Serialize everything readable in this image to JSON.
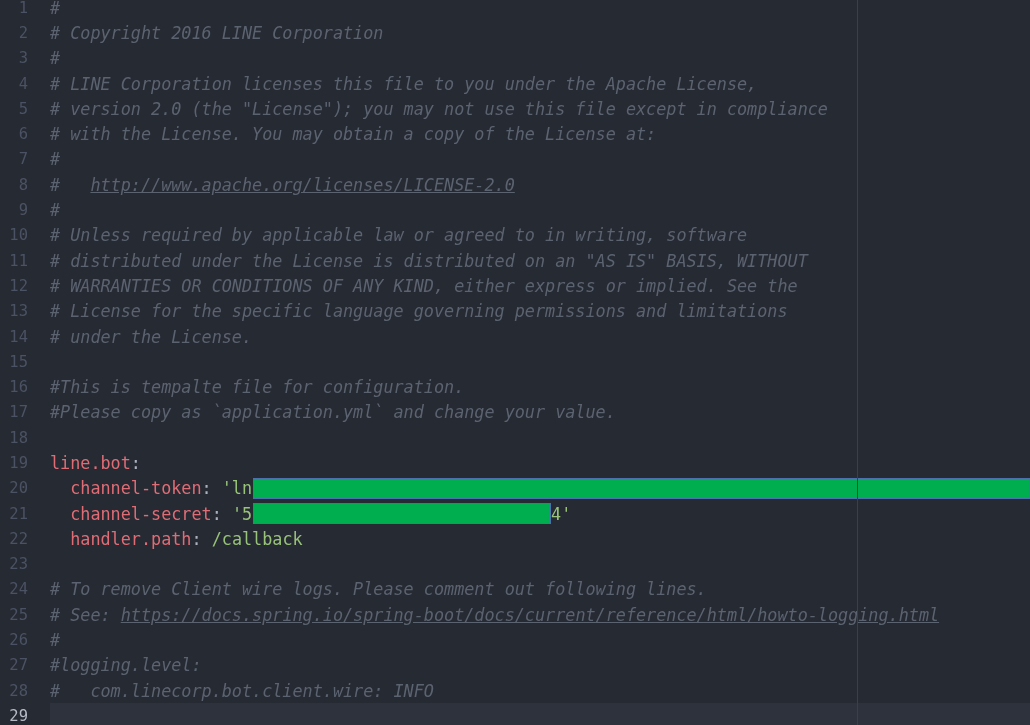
{
  "editor": {
    "lines": [
      {
        "number": "1",
        "current": false,
        "segments": [
          {
            "kind": "comment",
            "text": "#"
          }
        ]
      },
      {
        "number": "2",
        "current": false,
        "segments": [
          {
            "kind": "comment",
            "text": "# Copyright 2016 LINE Corporation"
          }
        ]
      },
      {
        "number": "3",
        "current": false,
        "segments": [
          {
            "kind": "comment",
            "text": "#"
          }
        ]
      },
      {
        "number": "4",
        "current": false,
        "segments": [
          {
            "kind": "comment",
            "text": "# LINE Corporation licenses this file to you under the Apache License,"
          }
        ]
      },
      {
        "number": "5",
        "current": false,
        "segments": [
          {
            "kind": "comment",
            "text": "# version 2.0 (the \"License\"); you may not use this file except in compliance"
          }
        ]
      },
      {
        "number": "6",
        "current": false,
        "segments": [
          {
            "kind": "comment",
            "text": "# with the License. You may obtain a copy of the License at:"
          }
        ]
      },
      {
        "number": "7",
        "current": false,
        "segments": [
          {
            "kind": "comment",
            "text": "#"
          }
        ]
      },
      {
        "number": "8",
        "current": false,
        "segments": [
          {
            "kind": "comment",
            "text": "#   "
          },
          {
            "kind": "link",
            "text": "http://www.apache.org/licenses/LICENSE-2.0"
          }
        ]
      },
      {
        "number": "9",
        "current": false,
        "segments": [
          {
            "kind": "comment",
            "text": "#"
          }
        ]
      },
      {
        "number": "10",
        "current": false,
        "segments": [
          {
            "kind": "comment",
            "text": "# Unless required by applicable law or agreed to in writing, software"
          }
        ]
      },
      {
        "number": "11",
        "current": false,
        "segments": [
          {
            "kind": "comment",
            "text": "# distributed under the License is distributed on an \"AS IS\" BASIS, WITHOUT"
          }
        ]
      },
      {
        "number": "12",
        "current": false,
        "segments": [
          {
            "kind": "comment",
            "text": "# WARRANTIES OR CONDITIONS OF ANY KIND, either express or implied. See the"
          }
        ]
      },
      {
        "number": "13",
        "current": false,
        "segments": [
          {
            "kind": "comment",
            "text": "# License for the specific language governing permissions and limitations"
          }
        ]
      },
      {
        "number": "14",
        "current": false,
        "segments": [
          {
            "kind": "comment",
            "text": "# under the License."
          }
        ]
      },
      {
        "number": "15",
        "current": false
      },
      {
        "number": "16",
        "current": false,
        "segments": [
          {
            "kind": "comment",
            "text": "#This is tempalte file for configuration."
          }
        ]
      },
      {
        "number": "17",
        "current": false,
        "segments": [
          {
            "kind": "comment",
            "text": "#Please copy as `application.yml` and change your value."
          }
        ]
      },
      {
        "number": "18",
        "current": false
      },
      {
        "number": "19",
        "current": false,
        "segments": [
          {
            "kind": "key",
            "text": "line.bot"
          },
          {
            "kind": "punct",
            "text": ":"
          }
        ]
      },
      {
        "number": "20",
        "current": false,
        "indented": true,
        "segments": [
          {
            "kind": "key",
            "text": "channel-token"
          },
          {
            "kind": "punct",
            "text": ": "
          },
          {
            "kind": "string",
            "text": "'ln"
          },
          {
            "kind": "redaction",
            "to_edge": true
          }
        ]
      },
      {
        "number": "21",
        "current": false,
        "indented": true,
        "segments": [
          {
            "kind": "key",
            "text": "channel-secret"
          },
          {
            "kind": "punct",
            "text": ": "
          },
          {
            "kind": "string",
            "text": "'5"
          },
          {
            "kind": "redaction",
            "to_edge": false
          },
          {
            "kind": "string",
            "text": "4'"
          }
        ]
      },
      {
        "number": "22",
        "current": false,
        "indented": true,
        "segments": [
          {
            "kind": "key",
            "text": "handler.path"
          },
          {
            "kind": "punct",
            "text": ": "
          },
          {
            "kind": "string",
            "text": "/callback"
          }
        ]
      },
      {
        "number": "23",
        "current": false
      },
      {
        "number": "24",
        "current": false,
        "segments": [
          {
            "kind": "comment",
            "text": "# To remove Client wire logs. Please comment out following lines."
          }
        ]
      },
      {
        "number": "25",
        "current": false,
        "segments": [
          {
            "kind": "comment",
            "text": "# See: "
          },
          {
            "kind": "link",
            "text": "https://docs.spring.io/spring-boot/docs/current/reference/html/howto-logging.html"
          }
        ]
      },
      {
        "number": "26",
        "current": false,
        "segments": [
          {
            "kind": "comment",
            "text": "#"
          }
        ]
      },
      {
        "number": "27",
        "current": false,
        "segments": [
          {
            "kind": "comment",
            "text": "#logging.level:"
          }
        ]
      },
      {
        "number": "28",
        "current": false,
        "segments": [
          {
            "kind": "comment",
            "text": "#   com.linecorp.bot.client.wire: INFO"
          }
        ]
      },
      {
        "number": "29",
        "current": true
      }
    ]
  }
}
